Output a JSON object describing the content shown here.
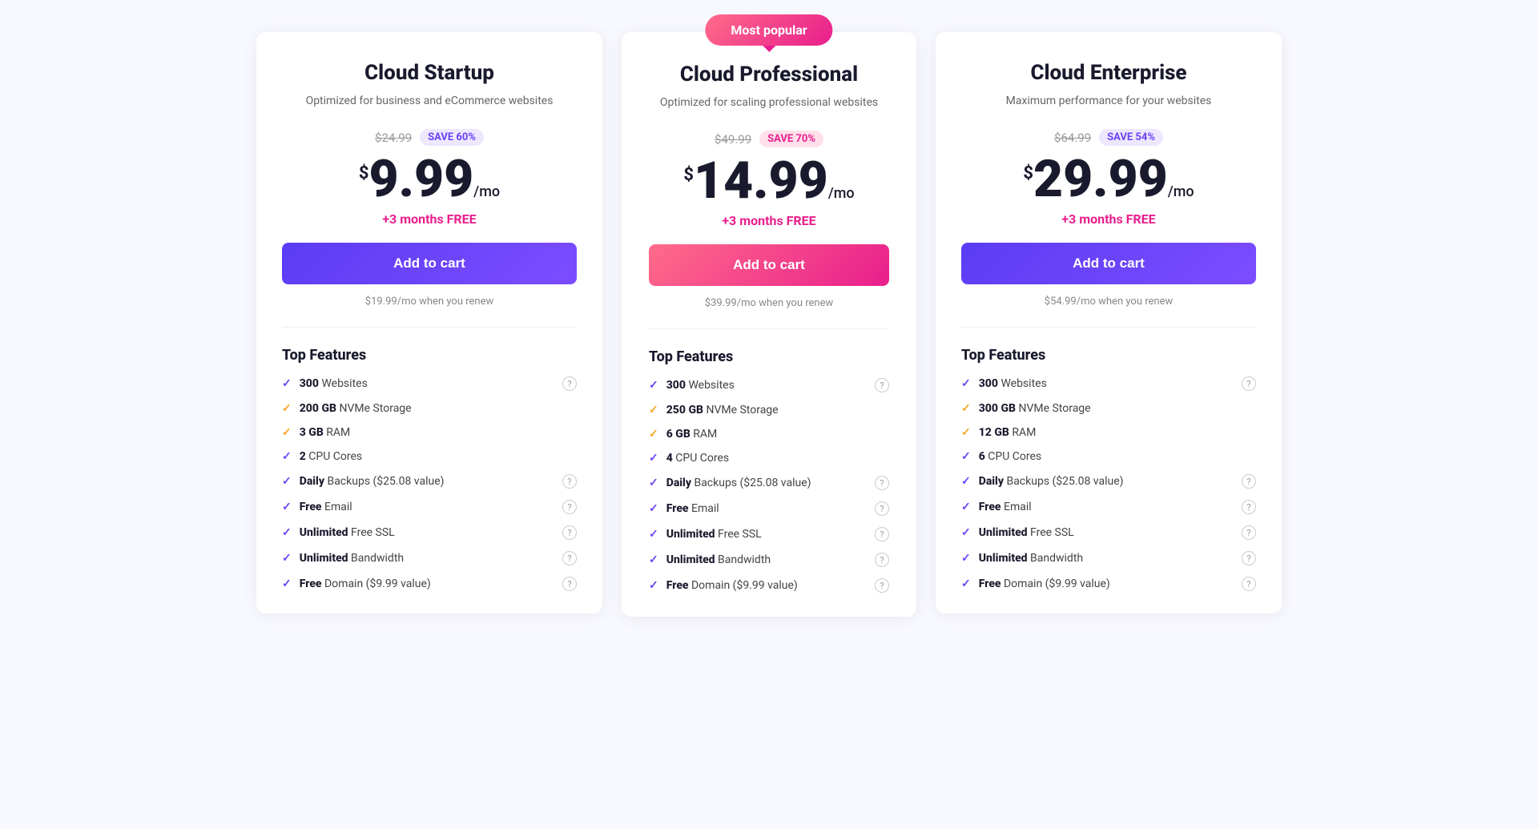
{
  "badge": {
    "label": "Most popular"
  },
  "plans": [
    {
      "id": "startup",
      "title": "Cloud Startup",
      "subtitle": "Optimized for business and eCommerce websites",
      "original_price": "$24.99",
      "save_badge": "SAVE 60%",
      "save_type": "purple",
      "price_dollar": "$",
      "price_amount": "9.99",
      "price_mo": "/mo",
      "free_months": "+3 months FREE",
      "btn_label": "Add to cart",
      "btn_type": "purple",
      "renew_text": "$19.99/mo when you renew",
      "features_title": "Top Features",
      "features": [
        {
          "bold": "300",
          "text": " Websites",
          "check": "purple",
          "info": true
        },
        {
          "bold": "200 GB",
          "text": " NVMe Storage",
          "check": "yellow",
          "info": false
        },
        {
          "bold": "3 GB",
          "text": " RAM",
          "check": "yellow",
          "info": false
        },
        {
          "bold": "2",
          "text": " CPU Cores",
          "check": "purple",
          "info": false
        },
        {
          "bold": "Daily",
          "text": " Backups ($25.08 value)",
          "check": "purple",
          "info": true
        },
        {
          "bold": "Free",
          "text": " Email",
          "check": "purple",
          "info": true
        },
        {
          "bold": "Unlimited",
          "text": " Free SSL",
          "check": "purple",
          "info": true
        },
        {
          "bold": "Unlimited",
          "text": " Bandwidth",
          "check": "purple",
          "info": true
        },
        {
          "bold": "Free",
          "text": " Domain ($9.99 value)",
          "check": "purple",
          "info": true
        }
      ]
    },
    {
      "id": "professional",
      "title": "Cloud Professional",
      "subtitle": "Optimized for scaling professional websites",
      "original_price": "$49.99",
      "save_badge": "SAVE 70%",
      "save_type": "pink",
      "price_dollar": "$",
      "price_amount": "14.99",
      "price_mo": "/mo",
      "free_months": "+3 months FREE",
      "btn_label": "Add to cart",
      "btn_type": "pink",
      "renew_text": "$39.99/mo when you renew",
      "features_title": "Top Features",
      "features": [
        {
          "bold": "300",
          "text": " Websites",
          "check": "purple",
          "info": true
        },
        {
          "bold": "250 GB",
          "text": " NVMe Storage",
          "check": "yellow",
          "info": false
        },
        {
          "bold": "6 GB",
          "text": " RAM",
          "check": "yellow",
          "info": false
        },
        {
          "bold": "4",
          "text": " CPU Cores",
          "check": "purple",
          "info": false
        },
        {
          "bold": "Daily",
          "text": " Backups ($25.08 value)",
          "check": "purple",
          "info": true
        },
        {
          "bold": "Free",
          "text": " Email",
          "check": "purple",
          "info": true
        },
        {
          "bold": "Unlimited",
          "text": " Free SSL",
          "check": "purple",
          "info": true
        },
        {
          "bold": "Unlimited",
          "text": " Bandwidth",
          "check": "purple",
          "info": true
        },
        {
          "bold": "Free",
          "text": " Domain ($9.99 value)",
          "check": "purple",
          "info": true
        }
      ]
    },
    {
      "id": "enterprise",
      "title": "Cloud Enterprise",
      "subtitle": "Maximum performance for your websites",
      "original_price": "$64.99",
      "save_badge": "SAVE 54%",
      "save_type": "purple",
      "price_dollar": "$",
      "price_amount": "29.99",
      "price_mo": "/mo",
      "free_months": "+3 months FREE",
      "btn_label": "Add to cart",
      "btn_type": "purple",
      "renew_text": "$54.99/mo when you renew",
      "features_title": "Top Features",
      "features": [
        {
          "bold": "300",
          "text": " Websites",
          "check": "purple",
          "info": true
        },
        {
          "bold": "300 GB",
          "text": " NVMe Storage",
          "check": "yellow",
          "info": false
        },
        {
          "bold": "12 GB",
          "text": " RAM",
          "check": "yellow",
          "info": false
        },
        {
          "bold": "6",
          "text": " CPU Cores",
          "check": "purple",
          "info": false
        },
        {
          "bold": "Daily",
          "text": " Backups ($25.08 value)",
          "check": "purple",
          "info": true
        },
        {
          "bold": "Free",
          "text": " Email",
          "check": "purple",
          "info": true
        },
        {
          "bold": "Unlimited",
          "text": " Free SSL",
          "check": "purple",
          "info": true
        },
        {
          "bold": "Unlimited",
          "text": " Bandwidth",
          "check": "purple",
          "info": true
        },
        {
          "bold": "Free",
          "text": " Domain ($9.99 value)",
          "check": "purple",
          "info": true
        }
      ]
    }
  ]
}
